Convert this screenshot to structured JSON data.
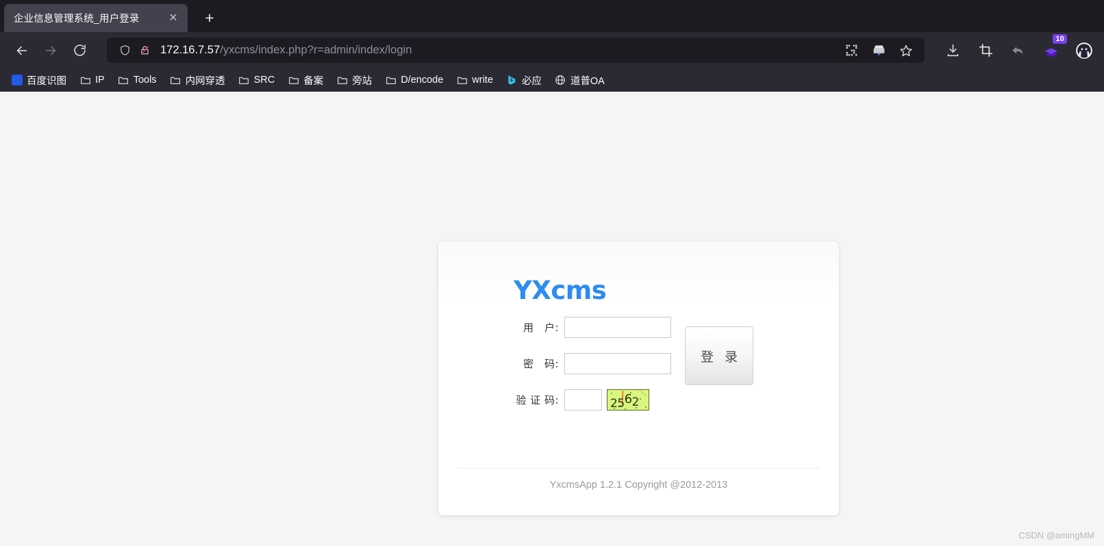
{
  "browser": {
    "tab": {
      "title": "企业信息管理系统_用户登录",
      "close_label": "✕"
    },
    "new_tab_label": "+",
    "nav": {
      "back_label": "Back",
      "forward_label": "Forward",
      "reload_label": "Reload"
    },
    "url": {
      "host": "172.16.7.57",
      "path": "/yxcms/index.php?r=admin/index/login",
      "full": "172.16.7.57/yxcms/index.php?r=admin/index/login",
      "shield_icon": "shield-icon",
      "lock_icon": "lock-crossed-icon"
    },
    "url_actions": [
      {
        "name": "qr-code-icon",
        "label": "QR Code"
      },
      {
        "name": "reader-save-icon",
        "label": "Save Page"
      },
      {
        "name": "bookmark-star-icon",
        "label": "Bookmark"
      }
    ],
    "toolbar_right": [
      {
        "name": "download-icon",
        "label": "Downloads"
      },
      {
        "name": "crop-icon",
        "label": "Screenshot"
      },
      {
        "name": "undo-icon",
        "label": "Undo"
      },
      {
        "name": "extension-stack-icon",
        "label": "Extension",
        "badge": "10"
      },
      {
        "name": "account-avatar-icon",
        "label": "Account"
      }
    ],
    "bookmarks": [
      {
        "label": "百度识图",
        "icon": "baidu-icon"
      },
      {
        "label": "IP",
        "icon": "folder-icon"
      },
      {
        "label": "Tools",
        "icon": "folder-icon"
      },
      {
        "label": "内网穿透",
        "icon": "folder-icon"
      },
      {
        "label": "SRC",
        "icon": "folder-icon"
      },
      {
        "label": "备案",
        "icon": "folder-icon"
      },
      {
        "label": "旁站",
        "icon": "folder-icon"
      },
      {
        "label": "D/encode",
        "icon": "folder-icon"
      },
      {
        "label": "write",
        "icon": "folder-icon"
      },
      {
        "label": "必应",
        "icon": "bing-icon"
      },
      {
        "label": "道普OA",
        "icon": "globe-icon"
      }
    ]
  },
  "login": {
    "brand": "YXcms",
    "fields": {
      "username_label": "用　户:",
      "username_value": "",
      "username_placeholder": "",
      "password_label": "密　码:",
      "password_value": "",
      "password_placeholder": "",
      "captcha_label": "验 证 码:",
      "captcha_value": "",
      "captcha_placeholder": ""
    },
    "captcha": {
      "text": "2562",
      "digits": [
        "2",
        "5",
        "6",
        "2"
      ],
      "background_color": "#dcf57e",
      "text_color": "#27351a"
    },
    "submit_label": "登 录",
    "footer": "YxcmsApp 1.2.1 Copyright @2012-2013",
    "brand_color": "#2d8cf0"
  },
  "watermark": "CSDN @amingMM"
}
